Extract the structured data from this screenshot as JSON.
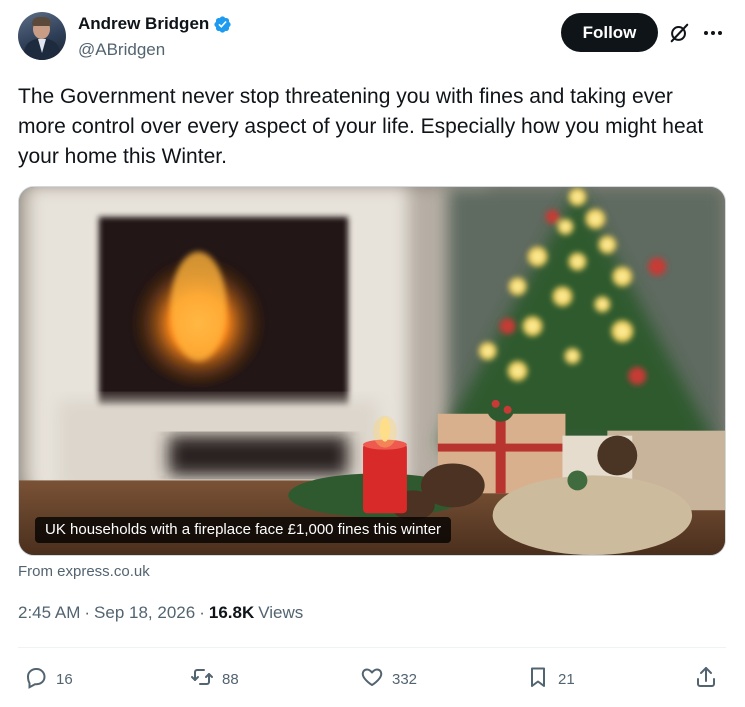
{
  "author": {
    "display_name": "Andrew Bridgen",
    "handle": "@ABridgen",
    "verified": true
  },
  "header": {
    "follow_label": "Follow",
    "icons": [
      "grok-icon",
      "more-icon"
    ]
  },
  "tweet": {
    "text": "The Government never stop threatening you with fines and taking ever more control over every aspect of your life. Especially how you might heat your home this Winter."
  },
  "card": {
    "caption": "UK households with a fireplace face £1,000 fines this winter",
    "source": "From express.co.uk"
  },
  "meta": {
    "time": "2:45 AM",
    "separator1": "·",
    "date": "Sep 18, 2026",
    "separator2": "·",
    "views_count": "16.8K",
    "views_label": "Views"
  },
  "actions": {
    "replies": "16",
    "reposts": "88",
    "likes": "332",
    "bookmarks": "21"
  },
  "colors": {
    "text_primary": "#0f1419",
    "text_secondary": "#536471",
    "verified_blue": "#1d9bf0",
    "follow_bg": "#0f1419"
  }
}
